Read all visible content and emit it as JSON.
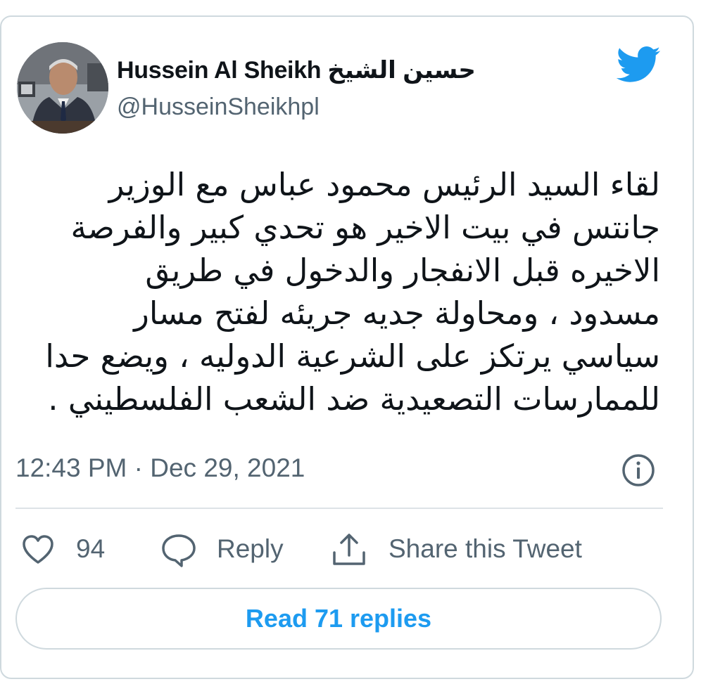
{
  "tweet": {
    "display_name": "Hussein Al Sheikh حسين الشيخ",
    "handle": "@HusseinSheikhpl",
    "text": "لقاء السيد الرئيس محمود عباس مع الوزير\nجانتس في بيت الاخير هو تحدي كبير والفرصة\nالاخيره قبل الانفجار والدخول في طريق\nمسدود ، ومحاولة جديه جريئه لفتح مسار\nسياسي يرتكز على الشرعية الدوليه ، ويضع حدا\nللممارسات التصعيدية ضد الشعب الفلسطيني .",
    "timestamp": "12:43 PM · Dec 29, 2021"
  },
  "actions": {
    "like_count": "94",
    "reply_label": "Reply",
    "share_label": "Share this Tweet"
  },
  "read_replies_label": "Read 71 replies",
  "icons": {
    "brand": "twitter-bird-icon",
    "info": "info-icon",
    "like": "heart-icon",
    "reply": "speech-bubble-icon",
    "share": "share-upload-icon"
  },
  "colors": {
    "brand_blue": "#1d9bf0",
    "text_primary": "#0f1419",
    "text_secondary": "#536471",
    "border": "#cfd9de"
  }
}
